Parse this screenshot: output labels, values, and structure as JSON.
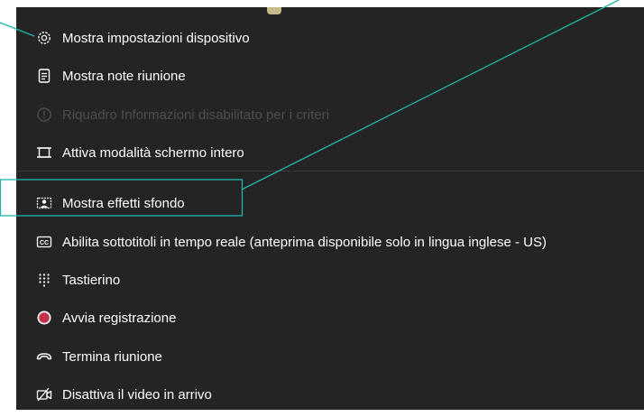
{
  "menu": {
    "items": [
      {
        "label": "Mostra impostazioni dispositivo",
        "icon": "gear-icon",
        "disabled": false
      },
      {
        "label": "Mostra note riunione",
        "icon": "notes-icon",
        "disabled": false
      },
      {
        "label": "Riquadro Informazioni disabilitato per i criteri",
        "icon": "info-icon",
        "disabled": true
      },
      {
        "label": "Attiva modalità schermo intero",
        "icon": "fullscreen-icon",
        "disabled": false
      },
      {
        "label": "Mostra effetti sfondo",
        "icon": "background-effects-icon",
        "disabled": false
      },
      {
        "label": "Abilita sottotitoli in tempo reale (anteprima disponibile solo in lingua inglese - US)",
        "icon": "closed-captions-icon",
        "disabled": false
      },
      {
        "label": "Tastierino",
        "icon": "dialpad-icon",
        "disabled": false
      },
      {
        "label": "Avvia registrazione",
        "icon": "record-icon",
        "disabled": false
      },
      {
        "label": "Termina riunione",
        "icon": "hang-up-icon",
        "disabled": false
      },
      {
        "label": "Disattiva il video in arrivo",
        "icon": "video-off-icon",
        "disabled": false
      }
    ]
  },
  "colors": {
    "menu_background": "#242424",
    "text": "#ffffff",
    "disabled_text": "#4d4d4d",
    "annotation": "#1fb5a8",
    "record": "#c4314b"
  }
}
